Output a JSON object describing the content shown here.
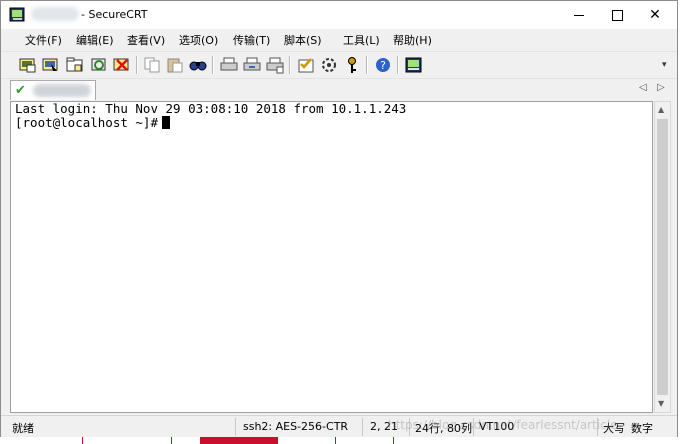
{
  "window": {
    "title": "- SecureCRT",
    "min_icon": "minimize-icon",
    "max_icon": "maximize-icon",
    "close_symbol": "✕"
  },
  "menu": [
    "文件(F)",
    "编辑(E)",
    "查看(V)",
    "选项(O)",
    "传输(T)",
    "脚本(S)",
    "工具(L)",
    "帮助(H)"
  ],
  "toolbar": {
    "buttons": [
      "connect-icon",
      "quick-connect-icon",
      "connect-in-tab-icon",
      "reconnect-icon",
      "disconnect-icon",
      "copy-icon",
      "paste-icon",
      "find-icon",
      "print-icon",
      "print-selection-icon",
      "print-setup-icon",
      "session-options-icon",
      "global-options-icon",
      "keymap-icon",
      "help-icon",
      "about-icon"
    ],
    "overflow_icon": "chevron-down-icon"
  },
  "tabs": {
    "session_status_icon": "checkmark-icon",
    "left_arrow": "◁",
    "right_arrow": "▷"
  },
  "terminal": {
    "lines": [
      "Last login: Thu Nov 29 03:08:10 2018 from 10.1.1.243",
      "[root@localhost ~]#"
    ]
  },
  "scrollbar": {
    "up": "▲",
    "down": "▼"
  },
  "statusbar": {
    "status": "就绪",
    "cipher": "ssh2: AES-256-CTR",
    "position": "2,  21",
    "size": "24行, 80列",
    "emulation": "VT100",
    "caps": "大写",
    "num": "数字"
  },
  "watermark": "https://blog.csdn.net/fearlessnt/article"
}
